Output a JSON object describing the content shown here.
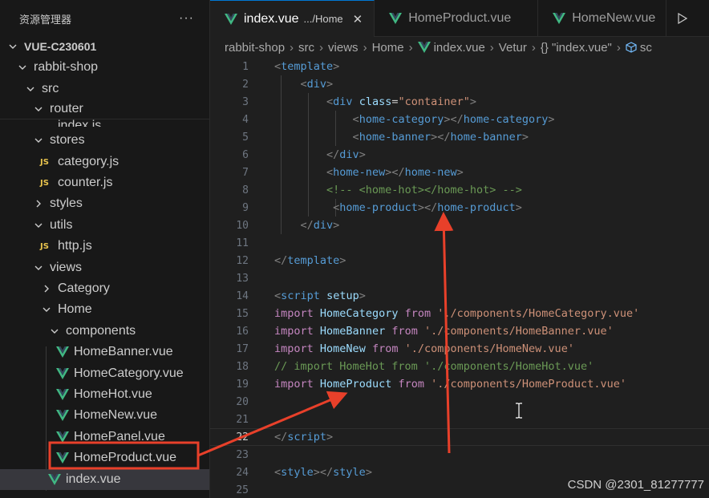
{
  "explorer": {
    "title": "资源管理器",
    "more_label": "···",
    "items": [
      {
        "label": "VUE-C230601",
        "type": "root"
      },
      {
        "label": "rabbit-shop",
        "type": "folder"
      },
      {
        "label": "src",
        "type": "folder"
      },
      {
        "label": "router",
        "type": "folder"
      },
      {
        "label": "index.js",
        "type": "js"
      },
      {
        "label": "stores",
        "type": "folder"
      },
      {
        "label": "category.js",
        "type": "js"
      },
      {
        "label": "counter.js",
        "type": "js"
      },
      {
        "label": "styles",
        "type": "folder"
      },
      {
        "label": "utils",
        "type": "folder"
      },
      {
        "label": "http.js",
        "type": "js"
      },
      {
        "label": "views",
        "type": "folder"
      },
      {
        "label": "Category",
        "type": "folder"
      },
      {
        "label": "Home",
        "type": "folder"
      },
      {
        "label": "components",
        "type": "folder"
      },
      {
        "label": "HomeBanner.vue",
        "type": "vue"
      },
      {
        "label": "HomeCategory.vue",
        "type": "vue"
      },
      {
        "label": "HomeHot.vue",
        "type": "vue"
      },
      {
        "label": "HomeNew.vue",
        "type": "vue"
      },
      {
        "label": "HomePanel.vue",
        "type": "vue"
      },
      {
        "label": "HomeProduct.vue",
        "type": "vue"
      },
      {
        "label": "index.vue",
        "type": "vue"
      }
    ]
  },
  "tabs": [
    {
      "label": "index.vue",
      "description": ".../Home",
      "close": "✕"
    },
    {
      "label": "HomeProduct.vue"
    },
    {
      "label": "HomeNew.vue"
    }
  ],
  "breadcrumb": {
    "parts": [
      "rabbit-shop",
      "src",
      "views",
      "Home",
      "index.vue",
      "Vetur",
      "{} \"index.vue\"",
      "sc"
    ]
  },
  "editor": {
    "current_line": 22,
    "line_numbers": [
      "1",
      "2",
      "3",
      "4",
      "5",
      "6",
      "7",
      "8",
      "9",
      "10",
      "11",
      "12",
      "13",
      "14",
      "15",
      "16",
      "17",
      "18",
      "19",
      "20",
      "21",
      "22",
      "23",
      "24",
      "25"
    ]
  },
  "watermark": "CSDN @2301_81277777",
  "colors": {
    "accent": "#0078d4",
    "annotation": "#e8402a",
    "vue_green": "#41b883"
  }
}
